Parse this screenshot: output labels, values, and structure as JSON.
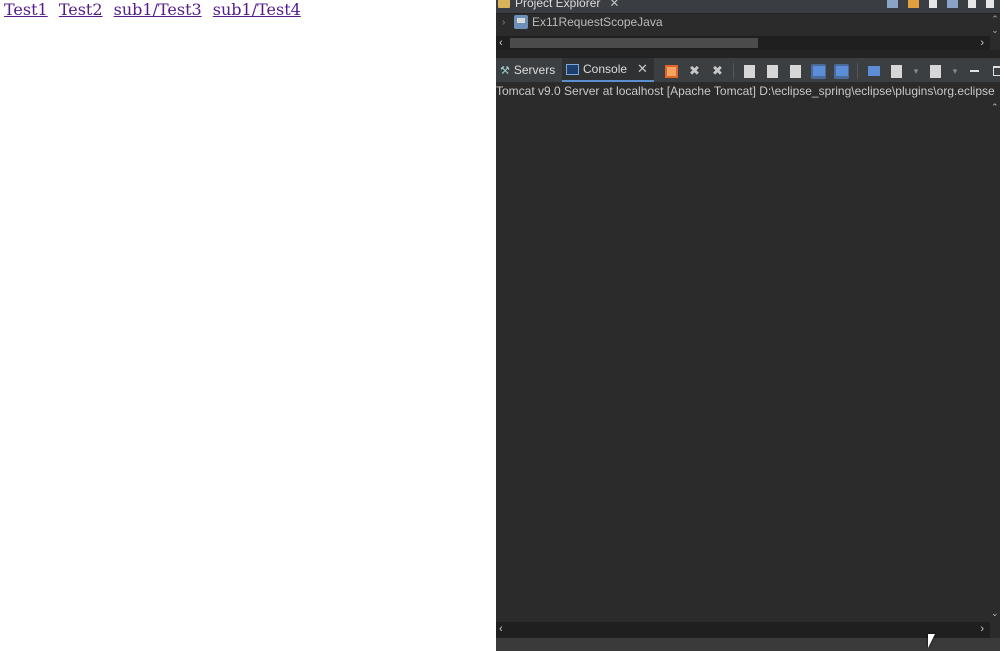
{
  "browser": {
    "links": [
      "Test1",
      "Test2",
      "sub1/Test3",
      "sub1/Test4"
    ]
  },
  "eclipse": {
    "project_explorer": {
      "tab_label": "Project Explorer",
      "close_glyph": "✕",
      "tree": [
        {
          "label": "Ex11RequestScopeJava",
          "expander": "›",
          "icon": "web-project-icon"
        }
      ]
    },
    "console_view": {
      "tabs": [
        {
          "label": "Servers",
          "icon": "servers-icon",
          "active": false
        },
        {
          "label": "Console",
          "icon": "console-icon",
          "active": true,
          "close_glyph": "✕"
        }
      ],
      "toolbar_icons": [
        "terminate-icon",
        "remove-launch-icon",
        "remove-all-terminated-icon",
        "clear-console-icon",
        "scroll-lock-icon",
        "word-wrap-icon",
        "show-console-stdout-icon",
        "show-console-stderr-icon",
        "pin-console-icon",
        "display-selected-console-icon",
        "open-console-icon",
        "minimize-icon",
        "maximize-icon"
      ],
      "process_label": "Tomcat v9.0 Server at localhost [Apache Tomcat] D:\\eclipse_spring\\eclipse\\plugins\\org.eclipse",
      "output": ""
    }
  },
  "colors": {
    "link_visited": "#551a8b",
    "eclipse_bg": "#2b2b2b",
    "tab_active_underline": "#5a8fd0"
  }
}
